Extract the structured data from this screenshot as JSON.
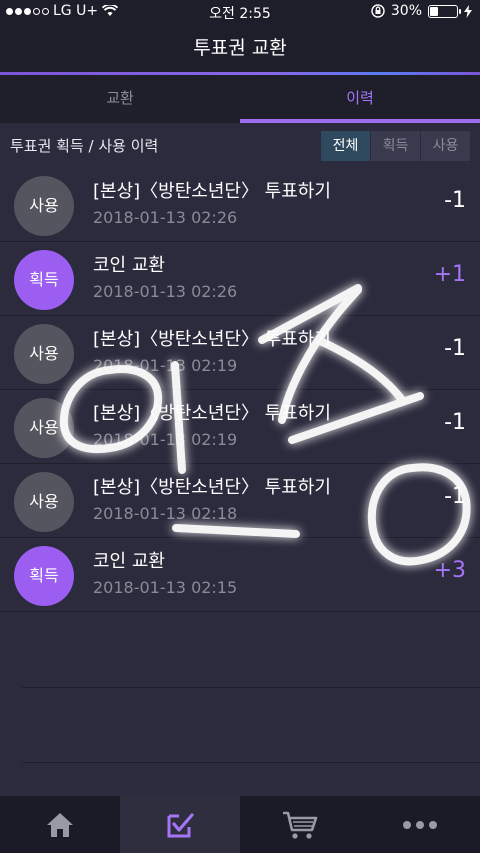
{
  "status_bar": {
    "carrier": "LG U+",
    "time": "오전 2:55",
    "battery_text": "30%",
    "battery_level": 0.3
  },
  "header": {
    "title": "투표권 교환"
  },
  "tabs": [
    {
      "label": "교환",
      "active": false
    },
    {
      "label": "이력",
      "active": true
    }
  ],
  "filter": {
    "title": "투표권 획득 / 사용 이력",
    "options": [
      {
        "label": "전체",
        "active": true
      },
      {
        "label": "획득",
        "active": false
      },
      {
        "label": "사용",
        "active": false
      }
    ]
  },
  "history": [
    {
      "badge": "사용",
      "type": "use",
      "title": "[본상]〈방탄소년단〉 투표하기",
      "date": "2018-01-13 02:26",
      "amount": "-1"
    },
    {
      "badge": "획득",
      "type": "earn",
      "title": "코인 교환",
      "date": "2018-01-13 02:26",
      "amount": "+1"
    },
    {
      "badge": "사용",
      "type": "use",
      "title": "[본상]〈방탄소년단〉 투표하기",
      "date": "2018-01-13 02:19",
      "amount": "-1"
    },
    {
      "badge": "사용",
      "type": "use",
      "title": "[본상]〈방탄소년단〉 투표하기",
      "date": "2018-01-13 02:19",
      "amount": "-1"
    },
    {
      "badge": "사용",
      "type": "use",
      "title": "[본상]〈방탄소년단〉 투표하기",
      "date": "2018-01-13 02:18",
      "amount": "-1"
    },
    {
      "badge": "획득",
      "type": "earn",
      "title": "코인 교환",
      "date": "2018-01-13 02:15",
      "amount": "+3"
    }
  ],
  "bottom_nav": [
    {
      "icon": "home-icon",
      "active": false
    },
    {
      "icon": "vote-check-icon",
      "active": true
    },
    {
      "icon": "cart-icon",
      "active": false
    },
    {
      "icon": "more-icon",
      "active": false
    }
  ],
  "colors": {
    "accent": "#9e6ef0",
    "background": "#2b2b3d",
    "earn_badge": "#9c5ef0",
    "use_badge": "#55555f"
  }
}
